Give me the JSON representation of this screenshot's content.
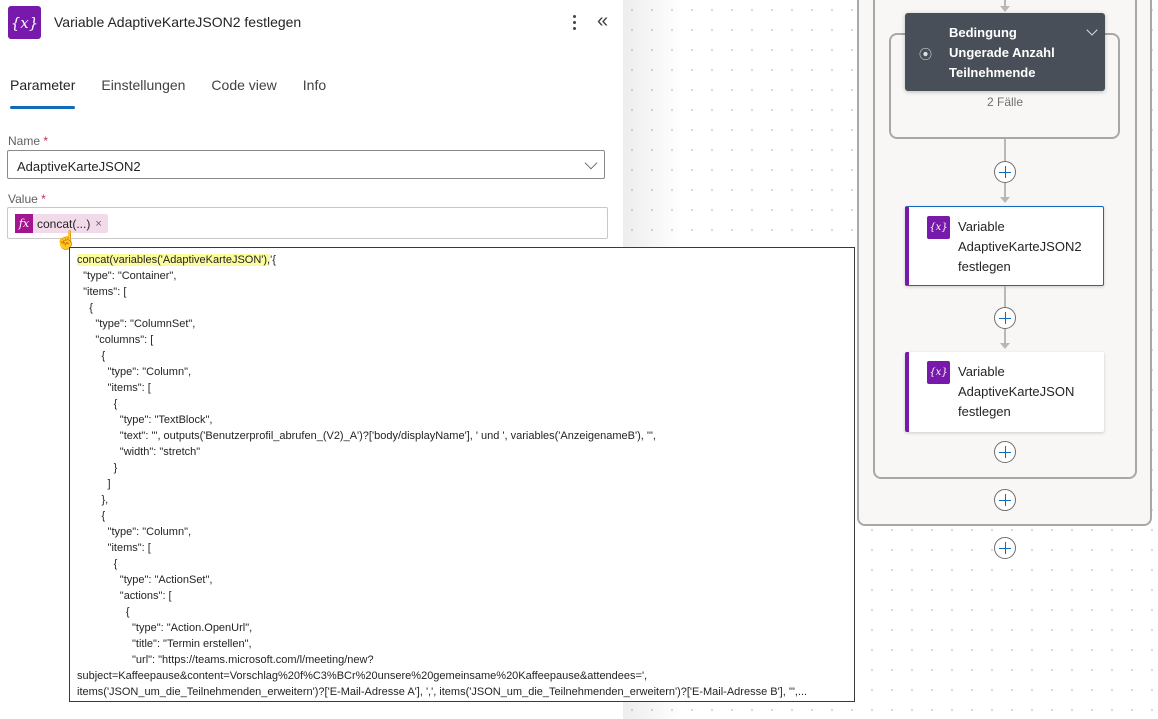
{
  "panel": {
    "icon": "variable-icon",
    "icon_glyph": "{x}",
    "title": "Variable AdaptiveKarteJSON2 festlegen",
    "more_glyph": "more-vertical-icon",
    "collapse_glyph": "«",
    "tabs": [
      {
        "label": "Parameter",
        "active": true
      },
      {
        "label": "Einstellungen",
        "active": false
      },
      {
        "label": "Code view",
        "active": false
      },
      {
        "label": "Info",
        "active": false
      }
    ],
    "name_label": "Name",
    "name_value": "AdaptiveKarteJSON2",
    "value_label": "Value",
    "required_mark": "*",
    "token": {
      "fx_glyph": "fx",
      "text": "concat(...)",
      "remove_glyph": "×"
    }
  },
  "tooltip": {
    "highlight": "concat(variables('AdaptiveKarteJSON'),",
    "lines": [
      "'{",
      "  \"type\": \"Container\",",
      "  \"items\": [",
      "    {",
      "      \"type\": \"ColumnSet\",",
      "      \"columns\": [",
      "        {",
      "          \"type\": \"Column\",",
      "          \"items\": [",
      "            {",
      "              \"type\": \"TextBlock\",",
      "              \"text\": \"', outputs('Benutzerprofil_abrufen_(V2)_A')?['body/displayName'], ' und ', variables('AnzeigenameB'), '\",",
      "              \"width\": \"stretch\"",
      "            }",
      "          ]",
      "        },",
      "        {",
      "          \"type\": \"Column\",",
      "          \"items\": [",
      "            {",
      "              \"type\": \"ActionSet\",",
      "              \"actions\": [",
      "                {",
      "                  \"type\": \"Action.OpenUrl\",",
      "                  \"title\": \"Termin erstellen\",",
      "                  \"url\": \"https://teams.microsoft.com/l/meeting/new?",
      "subject=Kaffeepause&content=Vorschlag%20f%C3%BCr%20unsere%20gemeinsame%20Kaffeepause&attendees=',",
      "items('JSON_um_die_Teilnehmenden_erweitern')?['E-Mail-Adresse A'], ',', items('JSON_um_die_Teilnehmenden_erweitern')?['E-Mail-Adresse B'], '\",..."
    ]
  },
  "canvas": {
    "condition": {
      "title_lines": [
        "Bedingung",
        "Ungerade Anzahl",
        "Teilnehmende"
      ],
      "cases": "2 Fälle"
    },
    "actions": [
      {
        "title_lines": [
          "Variable",
          "AdaptiveKarteJSON2",
          "festlegen"
        ],
        "selected": true
      },
      {
        "title_lines": [
          "Variable",
          "AdaptiveKarteJSON",
          "festlegen"
        ],
        "selected": false
      }
    ],
    "colors": {
      "accent": "#0f6cbd",
      "variable": "#7719aa",
      "condition": "#484f58",
      "expression": "#a4168f"
    }
  }
}
